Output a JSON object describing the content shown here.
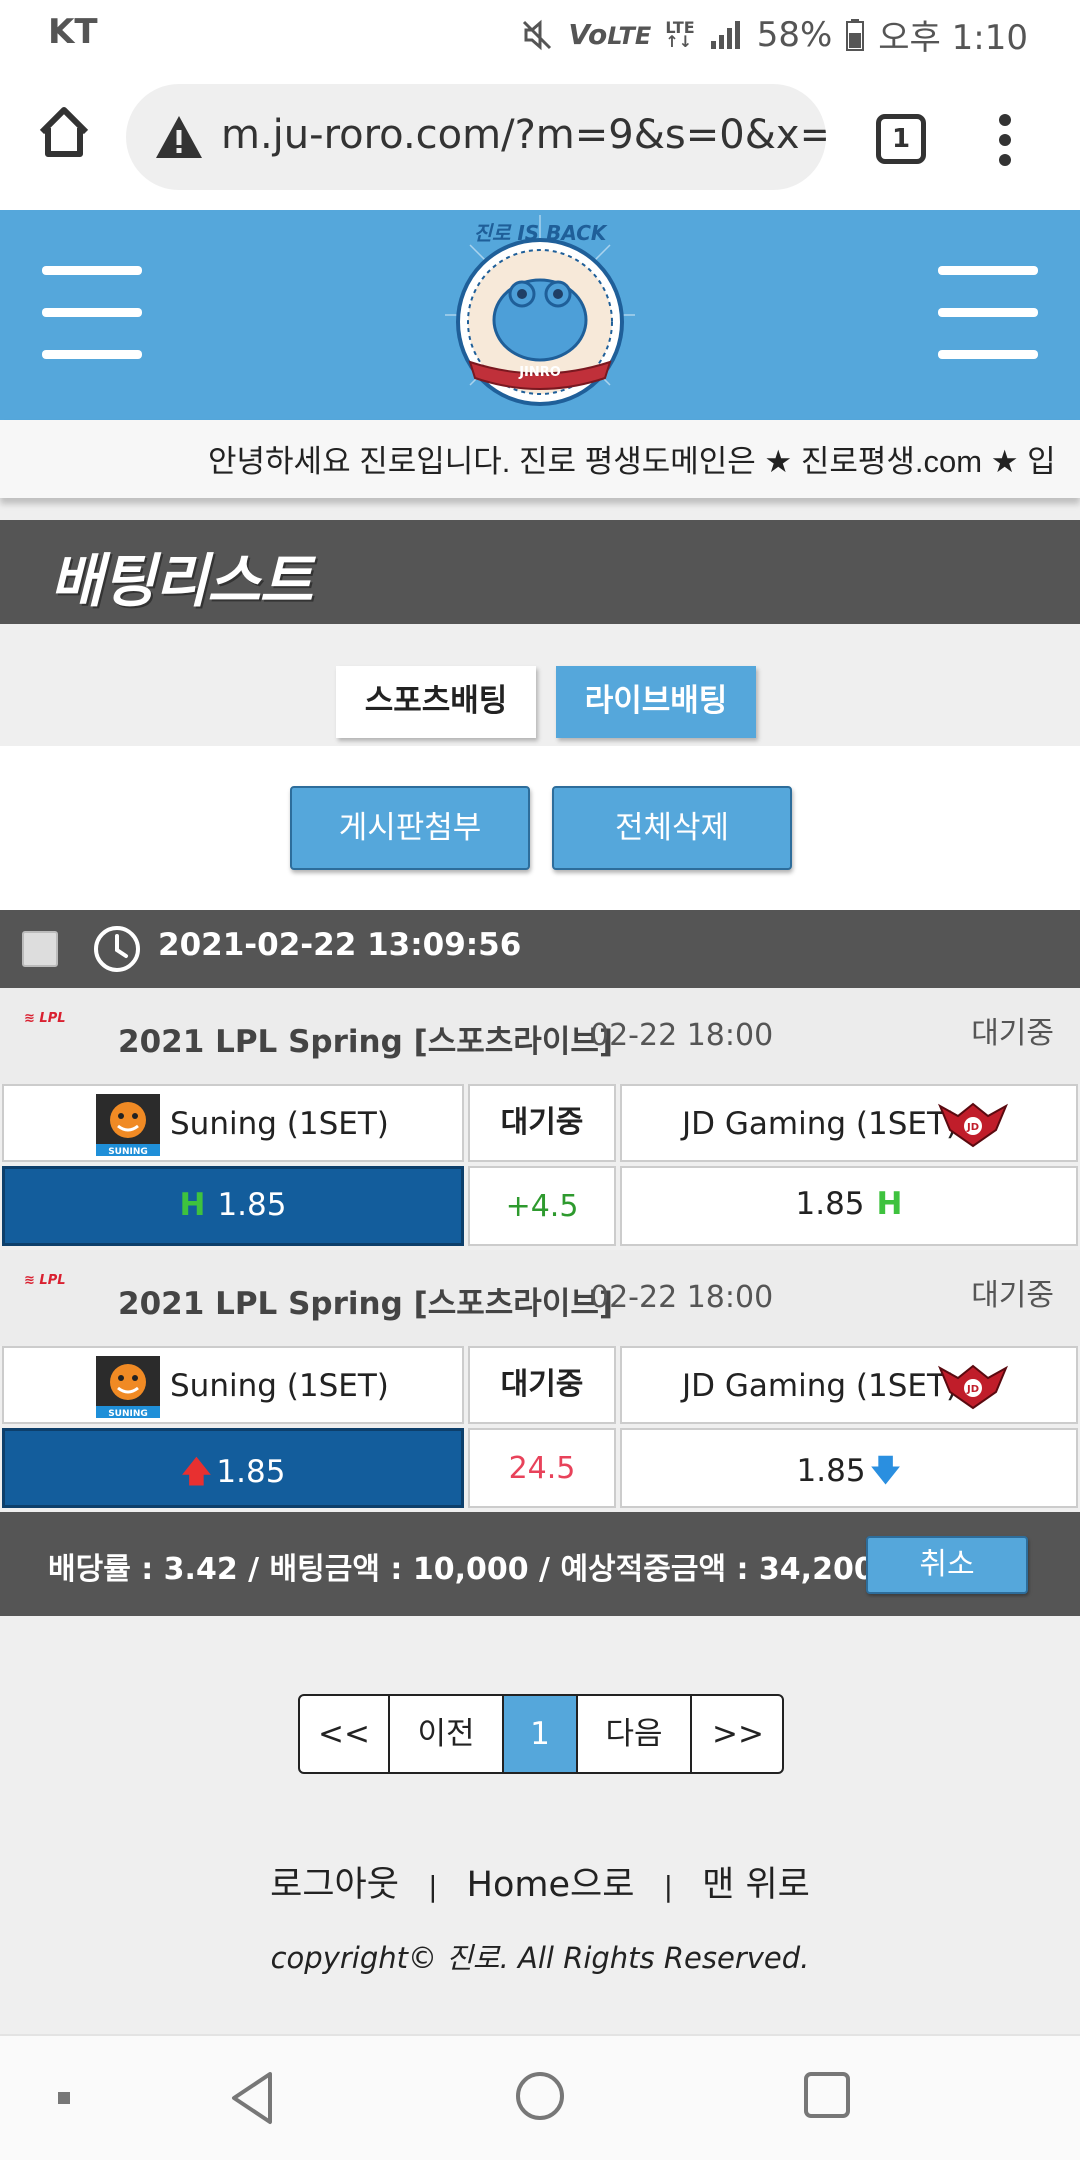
{
  "status_bar": {
    "carrier": "KT",
    "battery": "58%",
    "time": "오후 1:10"
  },
  "browser": {
    "url": "m.ju-roro.com/?m=9&s=0&x=",
    "tab_count": "1",
    "icons": [
      "home-icon",
      "warning-icon",
      "tabs-icon",
      "more-vert-icon"
    ]
  },
  "header": {
    "logo_text": "JINRO",
    "logo_slogan": "진로 IS BACK"
  },
  "notice": {
    "text": "안녕하세요 진로입니다. 진로 평생도메인은 ★ 진로평생.com ★ 입"
  },
  "page": {
    "title": "배팅리스트"
  },
  "tabs": {
    "sports": "스포츠배팅",
    "live": "라이브배팅"
  },
  "actions": {
    "attach": "게시판첨부",
    "delete_all": "전체삭제"
  },
  "slip": {
    "datetime": "2021-02-22 13:09:56",
    "matches": [
      {
        "league": "2021 LPL Spring [스포츠라이브]",
        "time": "02-22 18:00",
        "state": "대기중",
        "home": "Suning (1SET)",
        "middle": "대기중",
        "away": "JD Gaming (1SET)",
        "home_odds": "1.85",
        "handicap": "+4.5",
        "away_odds": "1.85",
        "handicap_color": "#2e9a2e",
        "marker": "handicap-h-icon"
      },
      {
        "league": "2021 LPL Spring [스포츠라이브]",
        "time": "02-22 18:00",
        "state": "대기중",
        "home": "Suning (1SET)",
        "middle": "대기중",
        "away": "JD Gaming (1SET)",
        "home_odds": "1.85",
        "handicap": "24.5",
        "away_odds": "1.85",
        "handicap_color": "#e8425a",
        "marker": "over-under-arrow-icon"
      }
    ],
    "summary": "배당률 : 3.42 / 배팅금액 : 10,000 / 예상적중금액 : 34,200",
    "cancel": "취소"
  },
  "pagination": {
    "first": "<<",
    "prev": "이전",
    "current": "1",
    "next": "다음",
    "last": ">>"
  },
  "footer": {
    "logout": "로그아웃",
    "home": "Home으로",
    "top": "맨 위로",
    "separator": "|",
    "copyright": "copyright© 진로. All Rights Reserved."
  },
  "colors": {
    "brand_blue": "#55a7db",
    "dark_gray": "#555555",
    "selected_blue": "#135d9c"
  }
}
